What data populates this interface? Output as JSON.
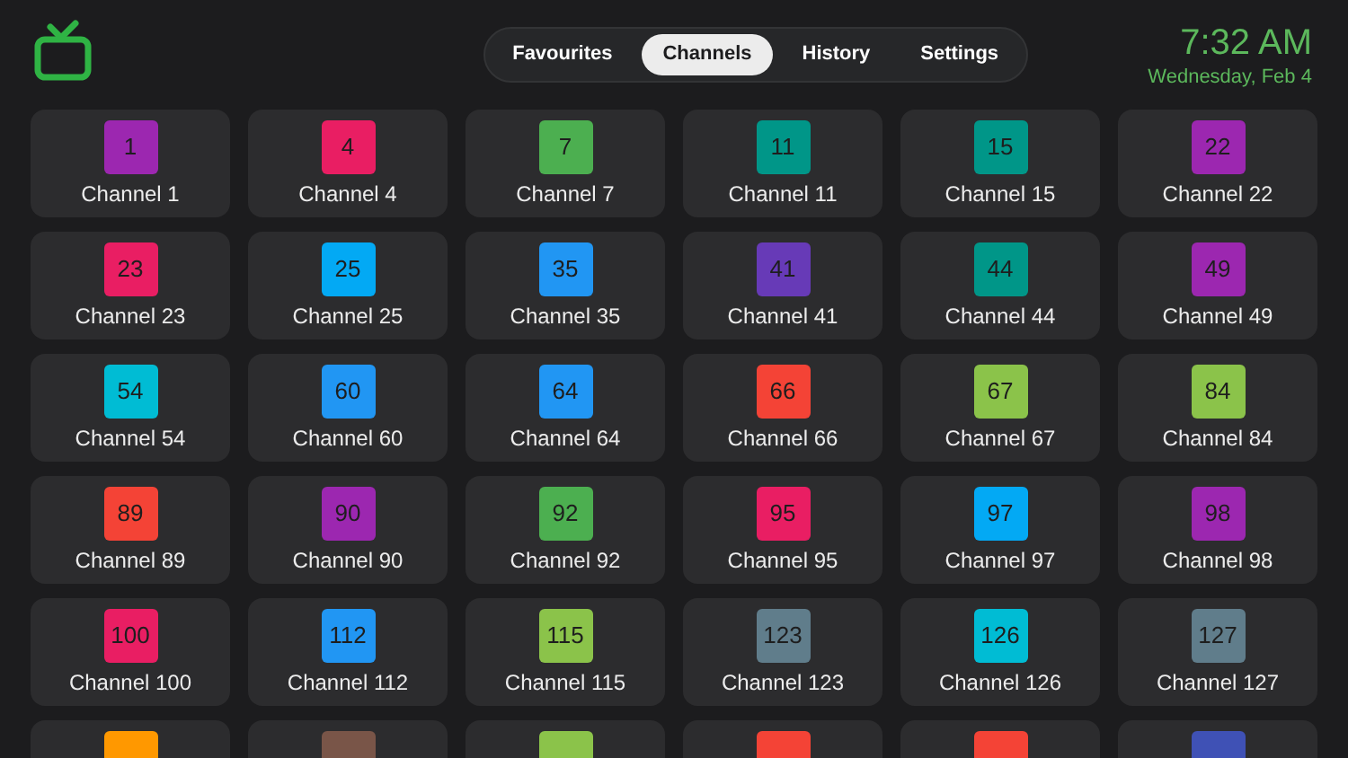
{
  "tabs": [
    {
      "label": "Favourites",
      "selected": false
    },
    {
      "label": "Channels",
      "selected": true
    },
    {
      "label": "History",
      "selected": false
    },
    {
      "label": "Settings",
      "selected": false
    }
  ],
  "clock": {
    "time": "7:32 AM",
    "date": "Wednesday, Feb 4"
  },
  "channels": [
    {
      "number": "1",
      "name": "Channel 1",
      "color": "#9c27b0"
    },
    {
      "number": "4",
      "name": "Channel 4",
      "color": "#e91e63"
    },
    {
      "number": "7",
      "name": "Channel 7",
      "color": "#4caf50"
    },
    {
      "number": "11",
      "name": "Channel 11",
      "color": "#009688"
    },
    {
      "number": "15",
      "name": "Channel 15",
      "color": "#009688"
    },
    {
      "number": "22",
      "name": "Channel 22",
      "color": "#9c27b0"
    },
    {
      "number": "23",
      "name": "Channel 23",
      "color": "#e91e63"
    },
    {
      "number": "25",
      "name": "Channel 25",
      "color": "#03a9f4"
    },
    {
      "number": "35",
      "name": "Channel 35",
      "color": "#2196f3"
    },
    {
      "number": "41",
      "name": "Channel 41",
      "color": "#673ab7"
    },
    {
      "number": "44",
      "name": "Channel 44",
      "color": "#009688"
    },
    {
      "number": "49",
      "name": "Channel 49",
      "color": "#9c27b0"
    },
    {
      "number": "54",
      "name": "Channel 54",
      "color": "#00bcd4"
    },
    {
      "number": "60",
      "name": "Channel 60",
      "color": "#2196f3"
    },
    {
      "number": "64",
      "name": "Channel 64",
      "color": "#2196f3"
    },
    {
      "number": "66",
      "name": "Channel 66",
      "color": "#f44336"
    },
    {
      "number": "67",
      "name": "Channel 67",
      "color": "#8bc34a"
    },
    {
      "number": "84",
      "name": "Channel 84",
      "color": "#8bc34a"
    },
    {
      "number": "89",
      "name": "Channel 89",
      "color": "#f44336"
    },
    {
      "number": "90",
      "name": "Channel 90",
      "color": "#9c27b0"
    },
    {
      "number": "92",
      "name": "Channel 92",
      "color": "#4caf50"
    },
    {
      "number": "95",
      "name": "Channel 95",
      "color": "#e91e63"
    },
    {
      "number": "97",
      "name": "Channel 97",
      "color": "#03a9f4"
    },
    {
      "number": "98",
      "name": "Channel 98",
      "color": "#9c27b0"
    },
    {
      "number": "100",
      "name": "Channel 100",
      "color": "#e91e63"
    },
    {
      "number": "112",
      "name": "Channel 112",
      "color": "#2196f3"
    },
    {
      "number": "115",
      "name": "Channel 115",
      "color": "#8bc34a"
    },
    {
      "number": "123",
      "name": "Channel 123",
      "color": "#607d8b"
    },
    {
      "number": "126",
      "name": "Channel 126",
      "color": "#00bcd4"
    },
    {
      "number": "127",
      "name": "Channel 127",
      "color": "#607d8b"
    },
    {
      "color": "#ff9800"
    },
    {
      "color": "#795548"
    },
    {
      "color": "#8bc34a"
    },
    {
      "color": "#f44336"
    },
    {
      "color": "#f44336"
    },
    {
      "color": "#3f51b5"
    }
  ]
}
